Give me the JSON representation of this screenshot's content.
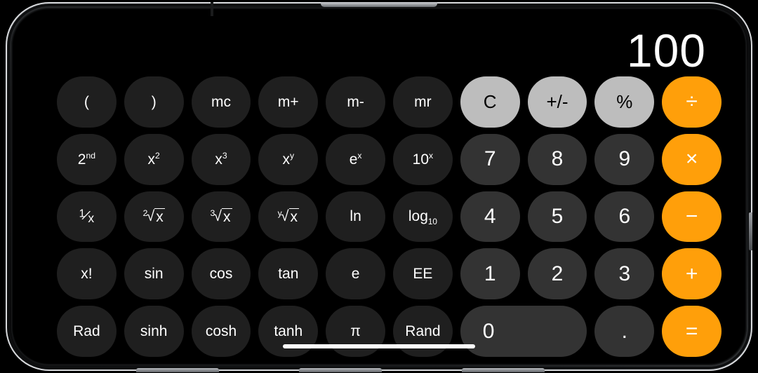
{
  "device": {
    "name": "iphone-landscape",
    "hardware": {
      "volume_button": "volume-button",
      "side_button": "side-button",
      "speaker": "earpiece-speaker",
      "camera": "front-camera",
      "home_indicator": "home-indicator"
    }
  },
  "app": {
    "name": "Calculator",
    "mode": "scientific"
  },
  "display": {
    "value": "100"
  },
  "keypad": {
    "rows": [
      [
        {
          "label": "(",
          "name": "key-open-paren",
          "style": "fn",
          "kind": "text"
        },
        {
          "label": ")",
          "name": "key-close-paren",
          "style": "fn",
          "kind": "text"
        },
        {
          "label": "mc",
          "name": "key-mc",
          "style": "fn",
          "kind": "text"
        },
        {
          "label": "m+",
          "name": "key-m-plus",
          "style": "fn",
          "kind": "text"
        },
        {
          "label": "m-",
          "name": "key-m-minus",
          "style": "fn",
          "kind": "text"
        },
        {
          "label": "mr",
          "name": "key-mr",
          "style": "fn",
          "kind": "text"
        },
        {
          "label": "C",
          "name": "key-clear",
          "style": "util",
          "kind": "text"
        },
        {
          "label": "+/-",
          "name": "key-sign-toggle",
          "style": "util",
          "kind": "text"
        },
        {
          "label": "%",
          "name": "key-percent",
          "style": "util",
          "kind": "text"
        },
        {
          "label": "÷",
          "name": "key-divide",
          "style": "op",
          "kind": "text"
        }
      ],
      [
        {
          "label": "2nd",
          "name": "key-second",
          "style": "fn",
          "kind": "sup",
          "base": "2",
          "sup": "nd"
        },
        {
          "label": "x²",
          "name": "key-x-squared",
          "style": "fn",
          "kind": "sup",
          "base": "x",
          "sup": "2"
        },
        {
          "label": "x³",
          "name": "key-x-cubed",
          "style": "fn",
          "kind": "sup",
          "base": "x",
          "sup": "3"
        },
        {
          "label": "xy",
          "name": "key-x-power-y",
          "style": "fn",
          "kind": "sup",
          "base": "x",
          "sup": "y"
        },
        {
          "label": "ex",
          "name": "key-e-power-x",
          "style": "fn",
          "kind": "sup",
          "base": "e",
          "sup": "x"
        },
        {
          "label": "10x",
          "name": "key-ten-power-x",
          "style": "fn",
          "kind": "sup",
          "base": "10",
          "sup": "x"
        },
        {
          "label": "7",
          "name": "key-7",
          "style": "num",
          "kind": "text"
        },
        {
          "label": "8",
          "name": "key-8",
          "style": "num",
          "kind": "text"
        },
        {
          "label": "9",
          "name": "key-9",
          "style": "num",
          "kind": "text"
        },
        {
          "label": "×",
          "name": "key-multiply",
          "style": "op",
          "kind": "text"
        }
      ],
      [
        {
          "label": "1/x",
          "name": "key-reciprocal",
          "style": "fn",
          "kind": "frac",
          "numerator": "1",
          "denominator": "x"
        },
        {
          "label": "²√x",
          "name": "key-square-root",
          "style": "fn",
          "kind": "root",
          "index": "2",
          "radicand": "x"
        },
        {
          "label": "³√x",
          "name": "key-cube-root",
          "style": "fn",
          "kind": "root",
          "index": "3",
          "radicand": "x"
        },
        {
          "label": "ʸ√x",
          "name": "key-nth-root",
          "style": "fn",
          "kind": "root",
          "index": "y",
          "radicand": "x"
        },
        {
          "label": "ln",
          "name": "key-ln",
          "style": "fn",
          "kind": "text"
        },
        {
          "label": "log10",
          "name": "key-log10",
          "style": "fn",
          "kind": "sub",
          "base": "log",
          "sub": "10"
        },
        {
          "label": "4",
          "name": "key-4",
          "style": "num",
          "kind": "text"
        },
        {
          "label": "5",
          "name": "key-5",
          "style": "num",
          "kind": "text"
        },
        {
          "label": "6",
          "name": "key-6",
          "style": "num",
          "kind": "text"
        },
        {
          "label": "−",
          "name": "key-subtract",
          "style": "op",
          "kind": "text"
        }
      ],
      [
        {
          "label": "x!",
          "name": "key-factorial",
          "style": "fn",
          "kind": "text"
        },
        {
          "label": "sin",
          "name": "key-sin",
          "style": "fn",
          "kind": "text"
        },
        {
          "label": "cos",
          "name": "key-cos",
          "style": "fn",
          "kind": "text"
        },
        {
          "label": "tan",
          "name": "key-tan",
          "style": "fn",
          "kind": "text"
        },
        {
          "label": "e",
          "name": "key-euler",
          "style": "fn",
          "kind": "text"
        },
        {
          "label": "EE",
          "name": "key-ee",
          "style": "fn",
          "kind": "text"
        },
        {
          "label": "1",
          "name": "key-1",
          "style": "num",
          "kind": "text"
        },
        {
          "label": "2",
          "name": "key-2",
          "style": "num",
          "kind": "text"
        },
        {
          "label": "3",
          "name": "key-3",
          "style": "num",
          "kind": "text"
        },
        {
          "label": "+",
          "name": "key-add",
          "style": "op",
          "kind": "text"
        }
      ],
      [
        {
          "label": "Rad",
          "name": "key-rad",
          "style": "fn",
          "kind": "text"
        },
        {
          "label": "sinh",
          "name": "key-sinh",
          "style": "fn",
          "kind": "text"
        },
        {
          "label": "cosh",
          "name": "key-cosh",
          "style": "fn",
          "kind": "text"
        },
        {
          "label": "tanh",
          "name": "key-tanh",
          "style": "fn",
          "kind": "text"
        },
        {
          "label": "π",
          "name": "key-pi",
          "style": "fn",
          "kind": "text"
        },
        {
          "label": "Rand",
          "name": "key-rand",
          "style": "fn",
          "kind": "text"
        },
        {
          "label": "0",
          "name": "key-0",
          "style": "num zero",
          "kind": "text"
        },
        {
          "label": ".",
          "name": "key-decimal",
          "style": "num",
          "kind": "text"
        },
        {
          "label": "=",
          "name": "key-equals",
          "style": "op",
          "kind": "text"
        }
      ]
    ]
  },
  "colors": {
    "accent_orange": "#ff9f0a",
    "util_gray": "#bdbdbd",
    "number_gray": "#333333",
    "function_gray": "#1f1f1f",
    "screen_black": "#000000",
    "text_white": "#ffffff"
  }
}
